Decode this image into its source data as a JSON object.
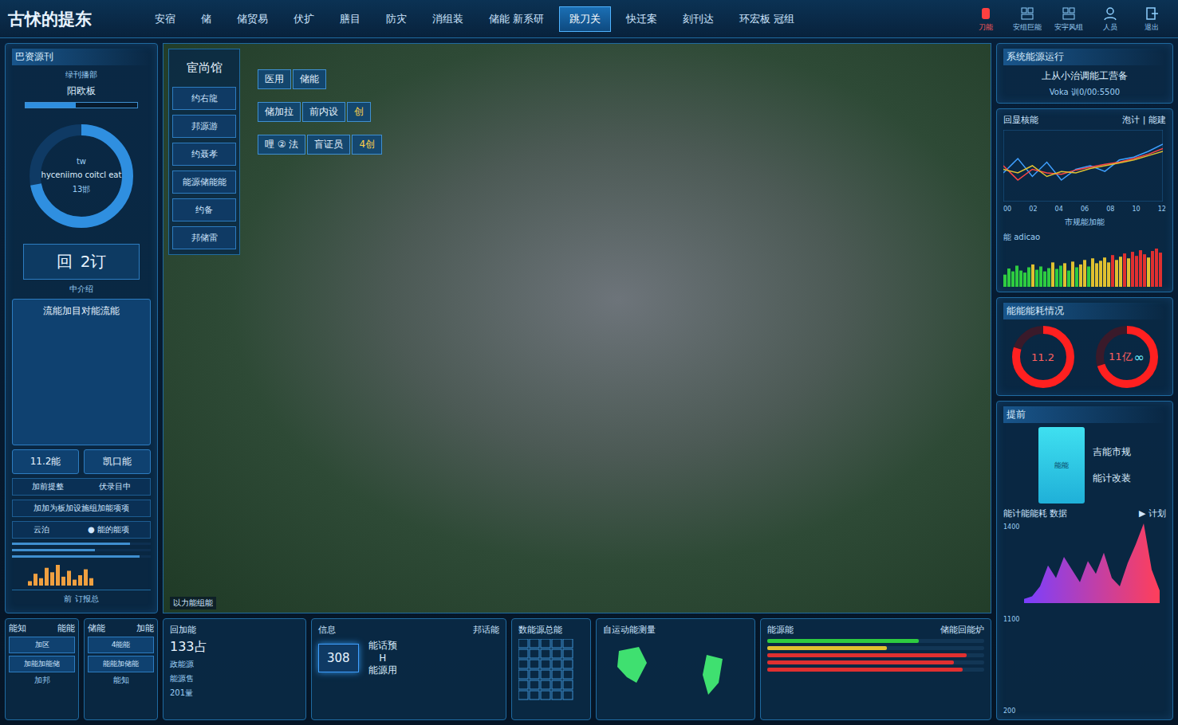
{
  "app": {
    "title": "古怵的提东"
  },
  "nav": [
    {
      "label": "安宿",
      "selected": false
    },
    {
      "label": "储",
      "selected": false
    },
    {
      "label": "储贸易",
      "selected": false
    },
    {
      "label": "伏扩",
      "selected": false
    },
    {
      "label": "膳目",
      "selected": false
    },
    {
      "label": "防灾",
      "selected": false
    },
    {
      "label": "消组装",
      "selected": false
    },
    {
      "label": "储能 新系研",
      "selected": false
    },
    {
      "label": "跳刀关",
      "selected": true
    },
    {
      "label": "快迁案",
      "selected": false
    },
    {
      "label": "刻刊达",
      "selected": false
    },
    {
      "label": "环宏板 冠组",
      "selected": false
    }
  ],
  "tools": [
    {
      "kind": "alarm",
      "label": "刀能"
    },
    {
      "kind": "grid",
      "label": "安组巨能"
    },
    {
      "kind": "grid",
      "label": "安宇风组"
    },
    {
      "kind": "user",
      "label": "人员"
    },
    {
      "kind": "exit",
      "label": "退出"
    }
  ],
  "left": {
    "title": "巴资源刊",
    "subtitle": "绿刊播部",
    "meter_label": "阳欧板",
    "meter_level": 0.45,
    "gauge": {
      "top": "tw",
      "center": "hyceniimo coitcl eat",
      "bottom": "13邯",
      "level": 0.72
    },
    "stat": {
      "icon": "回",
      "value": "2订"
    },
    "caption": "中介绍",
    "action": "流能加目对能流能",
    "buttons": [
      "11.2能",
      "凯口能"
    ],
    "rows": [
      [
        "加前提整",
        "伏录目中"
      ],
      [
        "加加为板加设施组加能项项"
      ],
      [
        "云泊",
        "● 能的能项"
      ]
    ],
    "lines": [
      0.85,
      0.6,
      0.92
    ],
    "mini": [
      3,
      8,
      5,
      12,
      9,
      14,
      6,
      10,
      4,
      7,
      11,
      5
    ],
    "footer": "前 订报总"
  },
  "left_cards": [
    {
      "title": "能知",
      "sub": "能能",
      "lines": [
        "加区",
        "加能加能储"
      ],
      "foot": "加邦"
    },
    {
      "title": "储能",
      "sub": "加能",
      "lines": [
        "4能能",
        "能能加储能"
      ],
      "foot": "能知"
    }
  ],
  "menu": {
    "title": "宦尚馆",
    "items": [
      "约右龍",
      "邦源游",
      "约聂孝",
      "能源储能能",
      "约备",
      "邦储雷"
    ]
  },
  "tags": [
    [
      "医用",
      "储能"
    ],
    [
      "储加拉",
      "前内设",
      "创"
    ],
    [
      "哩 ② 法",
      "盲证员",
      "4创"
    ]
  ],
  "photo_caption": "以力能组能",
  "status": {
    "title": "系统能源运行",
    "text": "上从小治调能工营备",
    "code": "Voka 训0/00:5500"
  },
  "trend": {
    "title": "回显核能",
    "legend": [
      "泡计",
      "能建"
    ],
    "ticks": [
      "00",
      "02",
      "04",
      "06",
      "08",
      "10",
      "12"
    ],
    "series": [
      {
        "color": "#3fa0ff",
        "values": [
          40,
          60,
          35,
          55,
          30,
          45,
          50,
          42,
          58,
          62,
          70,
          80
        ]
      },
      {
        "color": "#ff4545",
        "values": [
          50,
          30,
          45,
          40,
          38,
          44,
          48,
          52,
          55,
          60,
          66,
          74
        ]
      },
      {
        "color": "#e0c030",
        "values": [
          45,
          40,
          50,
          35,
          42,
          40,
          46,
          50,
          54,
          58,
          64,
          70
        ]
      }
    ]
  },
  "bars": {
    "title": "市规能加能",
    "legend": "能 adicao",
    "values": [
      30,
      45,
      38,
      52,
      40,
      35,
      48,
      55,
      42,
      50,
      38,
      46,
      60,
      44,
      52,
      58,
      40,
      62,
      48,
      55,
      66,
      50,
      70,
      58,
      64,
      72,
      60,
      78,
      66,
      74,
      82,
      70,
      86,
      76,
      90,
      80,
      72,
      88,
      94,
      84
    ]
  },
  "usage": {
    "title": "能能能耗情况",
    "donuts": [
      {
        "label": "11.2",
        "level": 0.8,
        "extra": ""
      },
      {
        "label": "11亿",
        "level": 0.7,
        "extra": "∞"
      }
    ]
  },
  "plan": {
    "title": "提前",
    "card_text": "能能",
    "card_lines": [
      "吉能市规",
      "能计改装"
    ],
    "chart_title": "能计能能耗 数据",
    "chart_action": "▶ 计划",
    "axis": [
      "1400",
      "1100",
      "200"
    ],
    "values": [
      5,
      8,
      20,
      45,
      30,
      55,
      40,
      25,
      50,
      35,
      60,
      30,
      20,
      48,
      70,
      95,
      40,
      15
    ]
  },
  "bottom": [
    {
      "kind": "stat",
      "title": "回加能",
      "side": "",
      "value": "133占",
      "lines": [
        "政能源",
        "能源售",
        "201量"
      ],
      "bars": []
    },
    {
      "kind": "dial",
      "title": "信息",
      "side": "邦话能",
      "value": "308",
      "lines": [
        "能话预",
        "H",
        "能源用"
      ],
      "bars": []
    },
    {
      "kind": "grid",
      "title": "数能源总能",
      "side": "",
      "value": "",
      "lines": [],
      "bars": []
    },
    {
      "kind": "map",
      "title": "自运动能测量",
      "side": "",
      "value": "",
      "lines": [],
      "bars": []
    },
    {
      "kind": "bars",
      "title": "能源能",
      "side": "储能回能炉",
      "value": "",
      "lines": [],
      "bars": [
        {
          "level": 0.7,
          "color": "#2ecc40"
        },
        {
          "level": 0.55,
          "color": "#e0c030"
        },
        {
          "level": 0.92,
          "color": "#e03030"
        },
        {
          "level": 0.86,
          "color": "#e03030"
        },
        {
          "level": 0.9,
          "color": "#e03030"
        }
      ]
    }
  ]
}
